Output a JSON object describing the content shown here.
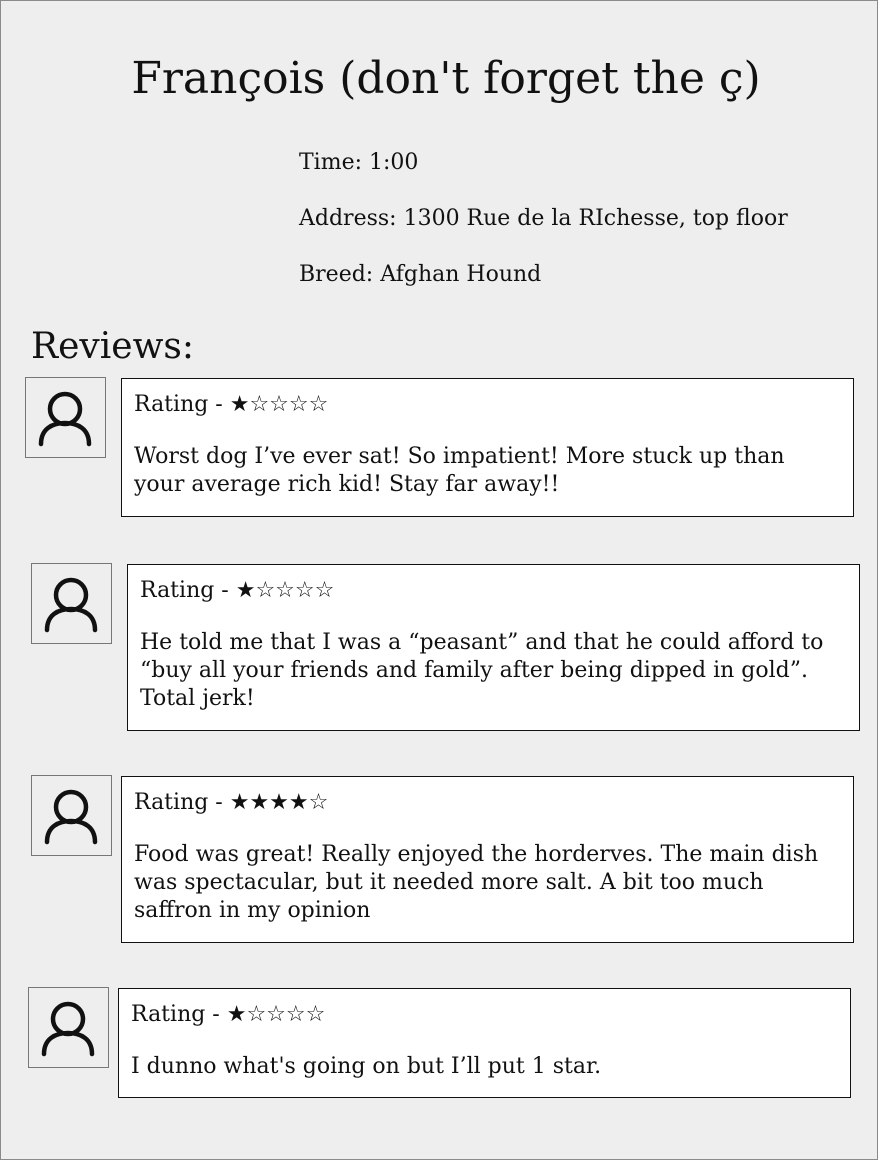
{
  "profile": {
    "title": "François (don't forget the ç)",
    "time": "Time: 1:00",
    "address": "Address: 1300 Rue de la RIchesse, top floor",
    "breed": "Breed: Afghan Hound"
  },
  "reviews_heading": "Reviews:",
  "reviews": [
    {
      "rating_prefix": "Rating - ",
      "rating": 1,
      "stars": "★☆☆☆☆",
      "text": "Worst dog I’ve ever sat! So impatient! More stuck up than your average rich kid! Stay far away!!",
      "avatar_icon": "user-icon"
    },
    {
      "rating_prefix": "Rating - ",
      "rating": 1,
      "stars": "★☆☆☆☆",
      "text": "He told me that I was a “peasant” and that he could afford to “buy all your friends and family after being dipped in gold”. Total jerk!",
      "avatar_icon": "user-icon"
    },
    {
      "rating_prefix": "Rating - ",
      "rating": 4,
      "stars": "★★★★☆",
      "text": "Food was great! Really enjoyed the horderves. The main dish was spectacular, but it needed more salt. A bit too much saffron in my opinion",
      "avatar_icon": "user-icon"
    },
    {
      "rating_prefix": "Rating - ",
      "rating": 1,
      "stars": "★☆☆☆☆",
      "text": "I dunno what's going on but I’ll put 1 star.",
      "avatar_icon": "user-icon"
    }
  ],
  "colors": {
    "page_background": "#eeeeee",
    "card_background": "#ffffff",
    "text": "#111111",
    "avatar_border": "#777777"
  }
}
